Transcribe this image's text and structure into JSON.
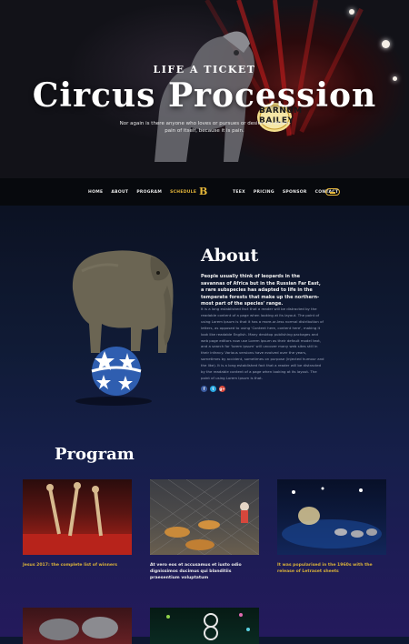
{
  "hero": {
    "kicker": "LIFE A TICKET",
    "title": "Circus Procession",
    "subtitle": "Nor again is there anyone who loves or pursues or desires to obtain pain of itself, because it is pain.",
    "banner_line1": "BARNUM",
    "banner_line2": "BAILEY"
  },
  "nav": {
    "left": [
      "HOME",
      "ABOUT",
      "PROGRAM",
      "SCHEDULE"
    ],
    "logo": "B",
    "right": [
      "TEEX",
      "PRICING",
      "SPONSOR",
      "CONTACT"
    ],
    "active": "SCHEDULE",
    "accent": "#e8b93a"
  },
  "about": {
    "title": "About",
    "lead": "People usually think of leopards in the savannas of Africa but in the Russian Far East, a rare subspecies has adapted to life in the temperate forests that make up the northern-most part of the species' range.",
    "body": "It is a long established fact that a reader will be distracted by the readable content of a page when looking at its layout. The point of using Lorem Ipsum is that it has a more-or-less normal distribution of letters, as opposed to using 'Content here, content here', making it look like readable English. Many desktop publishing packages and web page editors now use Lorem Ipsum as their default model text, and a search for 'lorem ipsum' will uncover many web sites still in their infancy. Various versions have evolved over the years, sometimes by accident, sometimes on purpose (injected humour and the like). It is a long established fact that a reader will be distracted by the readable content of a page when looking at its layout. The point of using Lorem Ipsum is that.",
    "social": [
      {
        "icon": "facebook-icon",
        "glyph": "f",
        "color": "#3b5ba0"
      },
      {
        "icon": "twitter-icon",
        "glyph": "t",
        "color": "#29a7e1"
      },
      {
        "icon": "google-plus-icon",
        "glyph": "g+",
        "color": "#d9483b"
      }
    ]
  },
  "program": {
    "title": "Program",
    "cards": [
      {
        "caption": "Jesus 2017: the complete list of winners",
        "style": "gold"
      },
      {
        "caption": "At vero eos et accusamus et iusto odio dignissimos ducimus qui blanditiis praesentium voluptatum",
        "style": "white"
      },
      {
        "caption": "It was popularised in the 1960s with the release of Letraset sheets",
        "style": "gold"
      }
    ]
  }
}
